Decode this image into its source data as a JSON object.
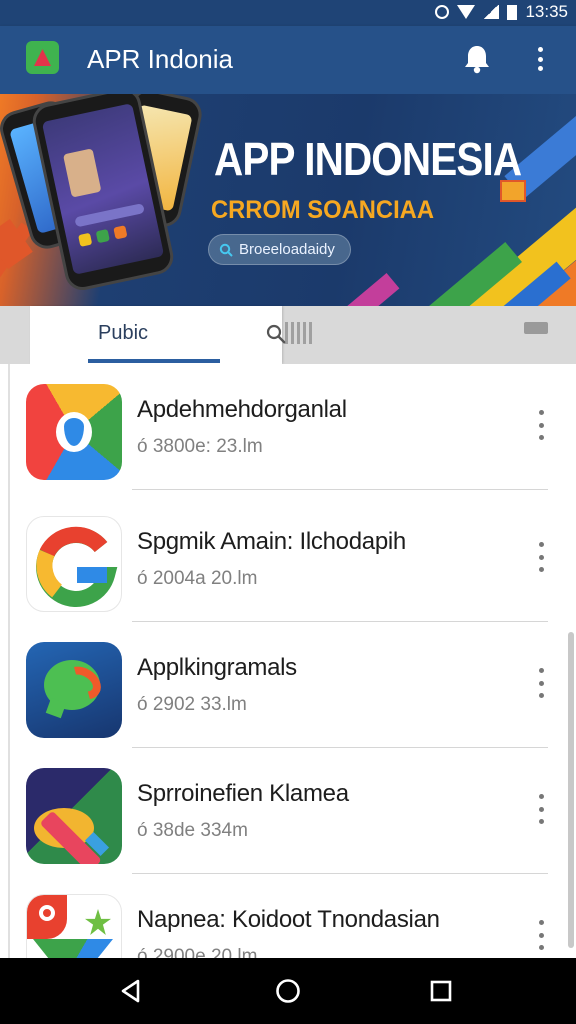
{
  "status_bar": {
    "time": "13:35",
    "icons": [
      "alarm-icon",
      "wifi-icon",
      "signal-icon",
      "battery-icon"
    ]
  },
  "app_bar": {
    "title": "APR Indonia",
    "icons": [
      "app-logo",
      "bell-icon",
      "more-vert-icon"
    ]
  },
  "banner": {
    "title": "APP INDONESIA",
    "subtitle": "CRROM SOANCIAA",
    "pill_label": "Broeeloadaidy",
    "colors": {
      "accent_orange": "#ef7a26",
      "navy": "#1e3f72",
      "subtitle_yellow": "#f6a821"
    }
  },
  "tabs": {
    "active_label": "Pubic",
    "icons": [
      "search-icon",
      "grid-icon",
      "more-icon"
    ]
  },
  "apps": [
    {
      "name": "Apdehmehdorganlal",
      "meta": "ó 3800e: 23.lm",
      "icon": "google-drive-style-icon"
    },
    {
      "name": "Spgmik Amain: Ilchodapih",
      "meta": "ó 2004a 20.lm",
      "icon": "google-g-icon"
    },
    {
      "name": "Applkingramals",
      "meta": "ó 2902 33.lm",
      "icon": "chat-bubble-icon"
    },
    {
      "name": "Sprroinefien Klamea",
      "meta": "ó 38de 334m",
      "icon": "pen-tool-icon"
    },
    {
      "name": "Napnea: Koidoot Tnondasian",
      "meta": "ó 2900e 20.lm",
      "icon": "maps-pin-icon"
    }
  ],
  "nav_bar": {
    "icons": [
      "back-icon",
      "home-icon",
      "recents-icon"
    ]
  }
}
